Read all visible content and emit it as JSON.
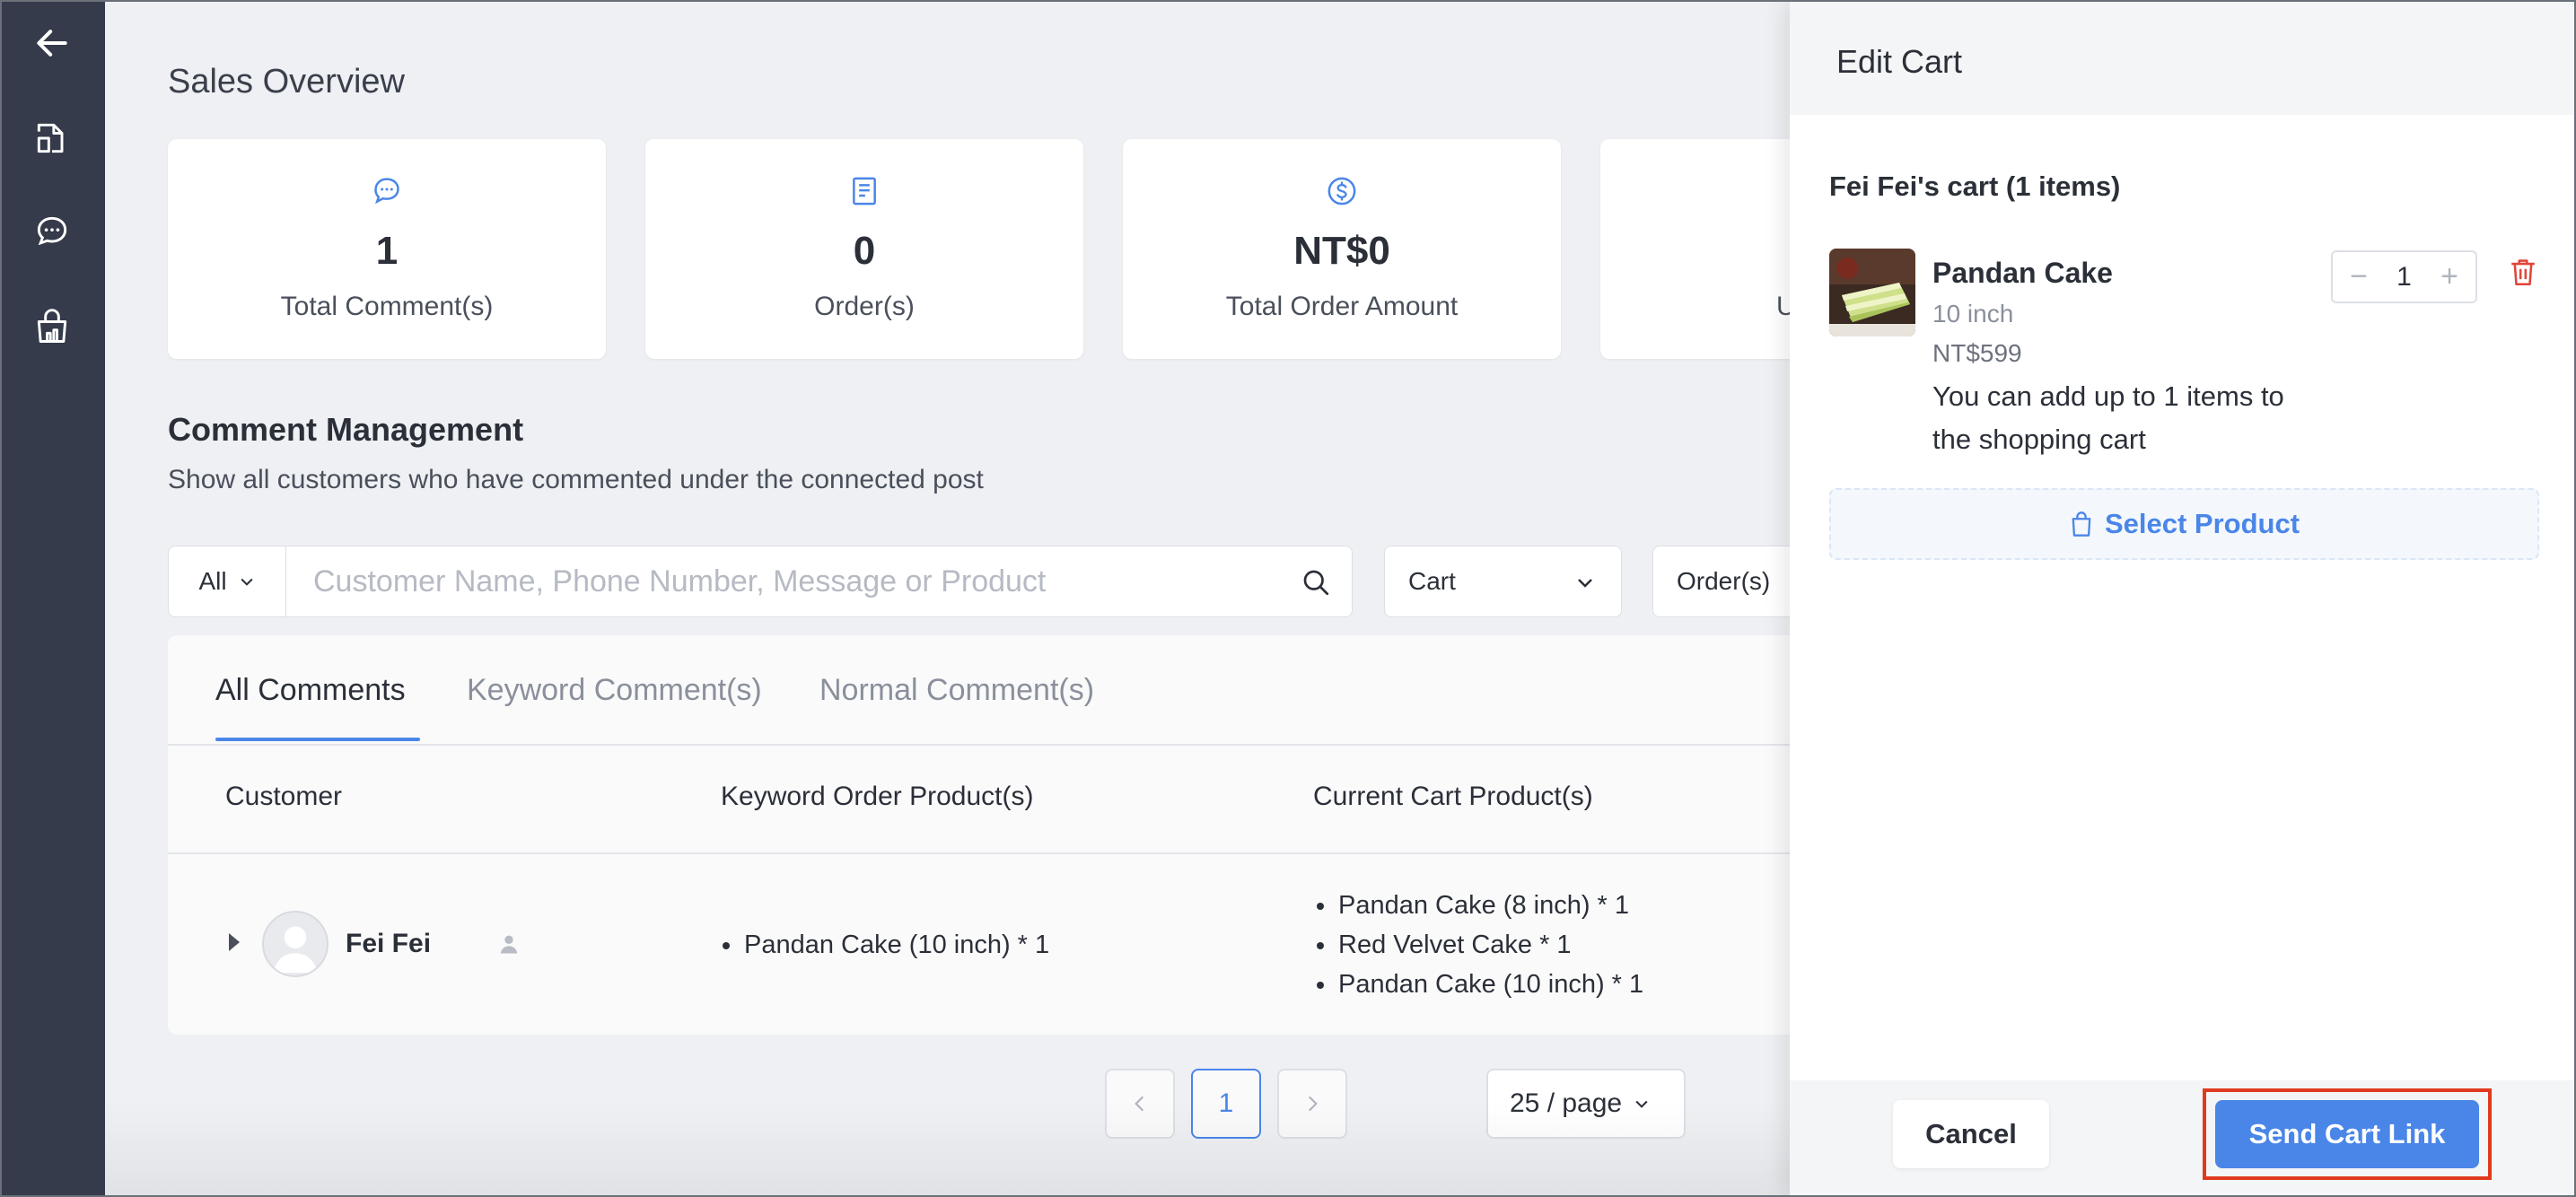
{
  "sidebar": {
    "icons": [
      "back-arrow-icon",
      "post-icon",
      "chat-icon",
      "shop-icon"
    ]
  },
  "main": {
    "title": "Sales Overview",
    "stats": [
      {
        "icon": "chat-bubble-icon",
        "value": "1",
        "label": "Total Comment(s)"
      },
      {
        "icon": "order-list-icon",
        "value": "0",
        "label": "Order(s)"
      },
      {
        "icon": "dollar-coin-icon",
        "value": "NT$0",
        "label": "Total Order Amount"
      },
      {
        "icon": "",
        "value": "",
        "label": "U"
      }
    ],
    "comment_section": {
      "title": "Comment Management",
      "subtitle": "Show all customers who have commented under the connected post"
    },
    "filters": {
      "scope": "All",
      "search_placeholder": "Customer Name, Phone Number, Message or Product",
      "cart_select": "Cart",
      "order_select": "Order(s)"
    },
    "tabs": [
      "All Comments",
      "Keyword Comment(s)",
      "Normal Comment(s)"
    ],
    "table": {
      "headers": [
        "Customer",
        "Keyword Order Product(s)",
        "Current Cart Product(s)"
      ],
      "rows": [
        {
          "customer": "Fei Fei",
          "keyword_products": [
            "Pandan Cake (10 inch) * 1"
          ],
          "cart_products": [
            "Pandan Cake (8 inch) * 1",
            "Red Velvet Cake  * 1",
            "Pandan Cake (10 inch) * 1"
          ]
        }
      ]
    },
    "pagination": {
      "current_page": "1",
      "page_size": "25 / page"
    }
  },
  "drawer": {
    "title": "Edit Cart",
    "cart_title": "Fei Fei's cart (1 items)",
    "item": {
      "name": "Pandan Cake",
      "variant": "10 inch",
      "price": "NT$599",
      "note": "You can add up to 1 items to the shopping cart",
      "quantity": "1"
    },
    "select_product": "Select Product",
    "cancel": "Cancel",
    "send": "Send Cart Link"
  },
  "colors": {
    "sidebar": "#353b4b",
    "accent": "#4a86e8",
    "highlight": "#e03a1e",
    "delete": "#e0453a"
  }
}
